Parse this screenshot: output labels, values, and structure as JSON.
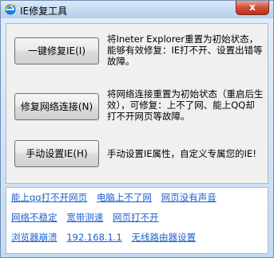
{
  "window": {
    "title": "IE修复工具",
    "close_label": "x"
  },
  "actions": [
    {
      "button_label": "一键修复IE(I)",
      "description": "将Ineter Explorer重置为初始状态，能够有效修复：IE打不开、设置出错等故障。"
    },
    {
      "button_label": "修复网络连接(N)",
      "description": "将网络连接重置为初始状态（重启后生效），可修复：上不了网、能上QQ却打不开网页等故障。"
    },
    {
      "button_label": "手动设置IE(H)",
      "description": "手动设置IE属性，自定义专属您的IE!"
    }
  ],
  "links": {
    "row1": [
      "能上qq打不开网页",
      "电脑上不了网",
      "网页没有声音"
    ],
    "row2": [
      "网络不稳定",
      "宽带测速",
      "网页打不开"
    ],
    "row3": [
      "浏览器崩溃",
      "192.168.1.1",
      "无线路由器设置"
    ]
  },
  "colors": {
    "link": "#1c5fd0",
    "close_button": "#c7371f",
    "window_frame": "#c6daf1"
  },
  "icons": {
    "app": "ie-logo-icon",
    "close": "close-icon"
  }
}
